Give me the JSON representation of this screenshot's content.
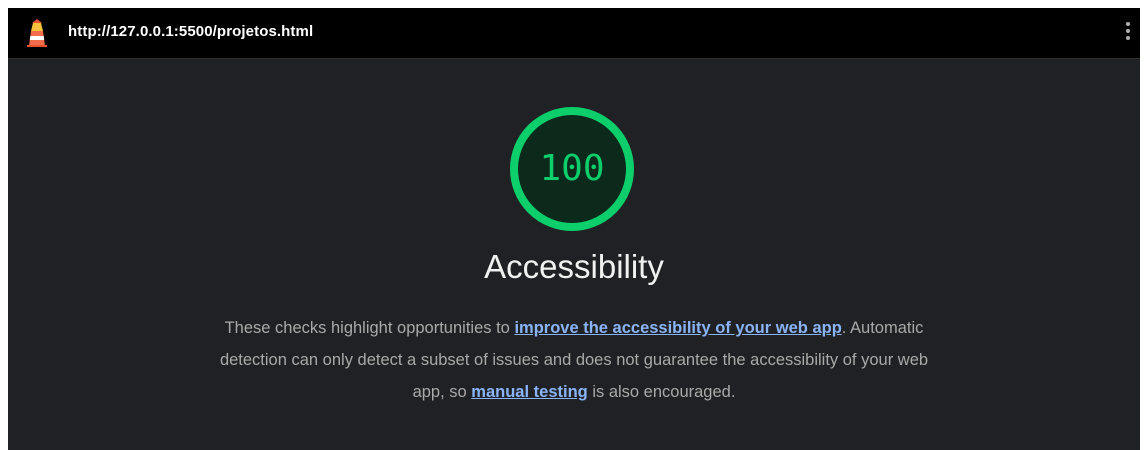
{
  "header": {
    "url": "http://127.0.0.1:5500/projetos.html",
    "logo_icon": "lighthouse-icon",
    "menu_icon": "kebab-menu-icon"
  },
  "category": {
    "score": "100",
    "score_fraction": 1.0,
    "score_color": "#0cce6b",
    "title": "Accessibility",
    "description": {
      "part1": "These checks highlight opportunities to ",
      "link1": "improve the accessibility of your web app",
      "part2": ". Automatic detection can only detect a subset of issues and does not guarantee the accessibility of your web app, so ",
      "link2": "manual testing",
      "part3": " is also encouraged."
    }
  },
  "colors": {
    "background": "#202124",
    "topbar": "#000000",
    "link": "#8ab4f8",
    "text": "#a9a9a9"
  }
}
